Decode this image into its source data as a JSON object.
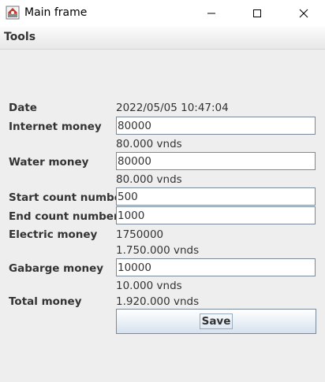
{
  "window": {
    "title": "Main frame",
    "icons": {
      "app": "app-icon",
      "minimize": "minimize-icon",
      "maximize": "maximize-icon",
      "close": "close-icon"
    }
  },
  "menu": {
    "tools_label": "Tools"
  },
  "form": {
    "date_label": "Date",
    "date_value": "2022/05/05 10:47:04",
    "internet_label": "Internet money",
    "internet_value": "80000",
    "internet_formatted": "80.000 vnds",
    "water_label": "Water money",
    "water_value": "80000",
    "water_formatted": "80.000 vnds",
    "start_label": "Start count number",
    "start_value": "500",
    "end_label": "End count number",
    "end_value": "1000",
    "electric_label": "Electric money",
    "electric_value": "1750000",
    "electric_formatted": "1.750.000 vnds",
    "garbage_label": "Gabarge money",
    "garbage_value": "10000",
    "garbage_formatted": "10.000 vnds",
    "total_label": "Total money",
    "total_formatted": "1.920.000 vnds",
    "save_label": "Save"
  },
  "colors": {
    "field_border": "#7a8a99",
    "button_gradient_bottom": "#d6e2ef",
    "background": "#eeeeee"
  }
}
